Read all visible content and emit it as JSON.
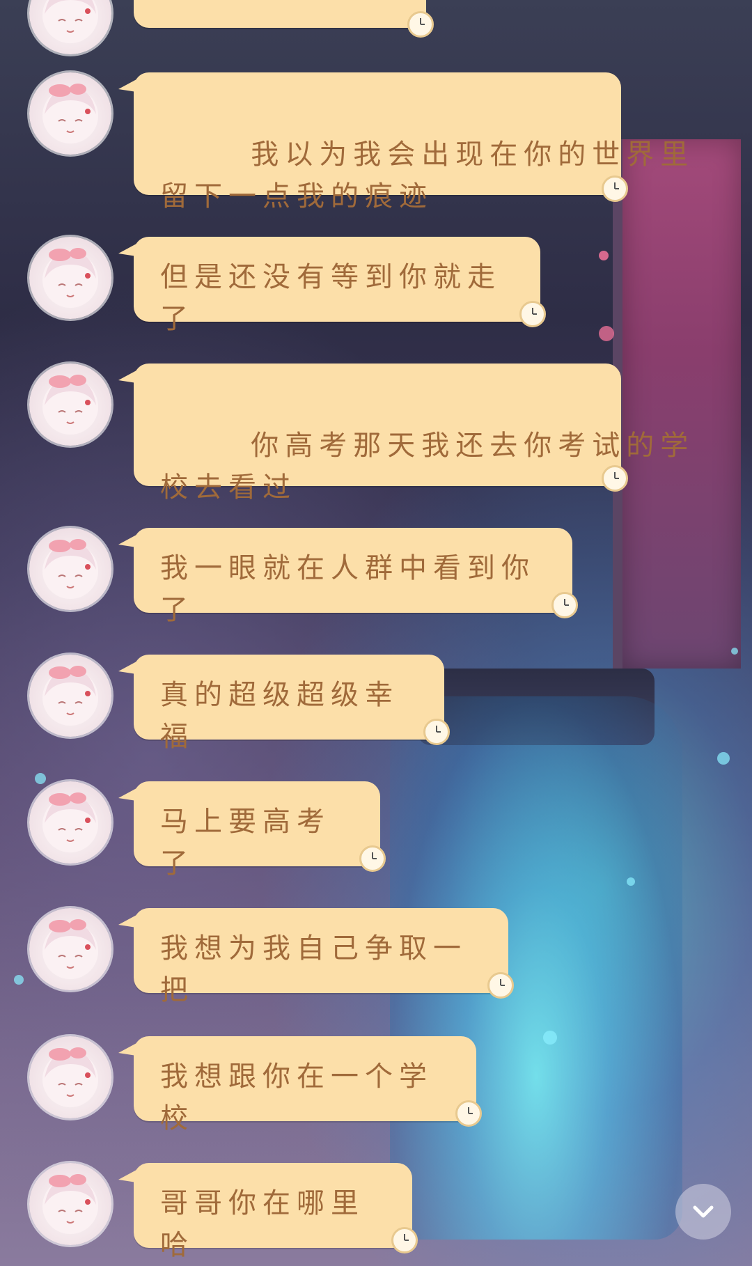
{
  "messages": [
    {
      "text": ""
    },
    {
      "text": "我以为我会出现在你的世界里\n留下一点我的痕迹"
    },
    {
      "text": "但是还没有等到你就走了"
    },
    {
      "text": "你高考那天我还去你考试的学\n校去看过"
    },
    {
      "text": "我一眼就在人群中看到你了"
    },
    {
      "text": "真的超级超级幸福"
    },
    {
      "text": "马上要高考了"
    },
    {
      "text": "我想为我自己争取一把"
    },
    {
      "text": "我想跟你在一个学校"
    },
    {
      "text": "哥哥你在哪里哈"
    }
  ],
  "icons": {
    "avatar": "avatar-icon",
    "clock": "clock-icon",
    "scroll": "chevron-down-icon"
  },
  "colors": {
    "bubble": "#fcdfa9",
    "bubble_text": "#a06a3a"
  }
}
